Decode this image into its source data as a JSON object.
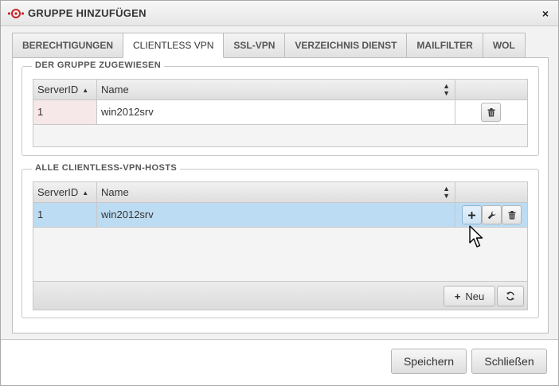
{
  "dialog": {
    "title": "GRUPPE HINZUFÜGEN",
    "close_label": "×"
  },
  "tabs": [
    {
      "label": "BERECHTIGUNGEN",
      "active": false
    },
    {
      "label": "CLIENTLESS VPN",
      "active": true
    },
    {
      "label": "SSL-VPN",
      "active": false
    },
    {
      "label": "VERZEICHNIS DIENST",
      "active": false
    },
    {
      "label": "MAILFILTER",
      "active": false
    },
    {
      "label": "WOL",
      "active": false
    }
  ],
  "assigned": {
    "legend": "DER GRUPPE ZUGEWIESEN",
    "columns": {
      "id": "ServerID",
      "name": "Name"
    },
    "rows": [
      {
        "id": "1",
        "name": "win2012srv"
      }
    ],
    "row_actions": [
      "trash-icon"
    ]
  },
  "all_hosts": {
    "legend": "ALLE CLIENTLESS-VPN-HOSTS",
    "columns": {
      "id": "ServerID",
      "name": "Name"
    },
    "rows": [
      {
        "id": "1",
        "name": "win2012srv",
        "selected": true
      }
    ],
    "row_actions": [
      "plus-icon",
      "wrench-icon",
      "trash-icon"
    ],
    "new_button": "Neu",
    "new_icon": "+"
  },
  "footer": {
    "save": "Speichern",
    "close": "Schließen"
  },
  "colors": {
    "selected_row": "#bcdcf3",
    "sorted_cell": "#f6e8e8",
    "logo_red": "#cc2229"
  }
}
